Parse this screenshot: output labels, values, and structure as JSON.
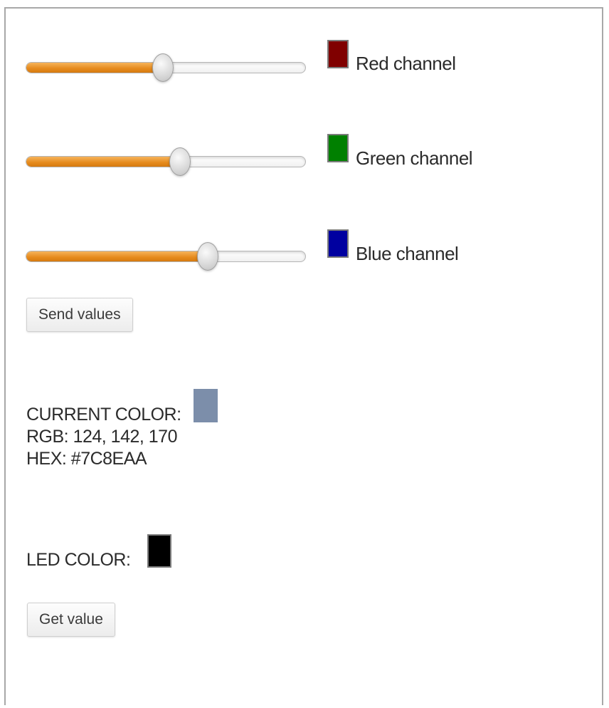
{
  "channels": [
    {
      "label": "Red channel",
      "level": 0.49,
      "swatch_color": "#800000"
    },
    {
      "label": "Green channel",
      "level": 0.55,
      "swatch_color": "#008000"
    },
    {
      "label": "Blue channel",
      "level": 0.65,
      "swatch_color": "#0000a0"
    }
  ],
  "send_button_label": "Send values",
  "current": {
    "title": "CURRENT COLOR:",
    "rgb_text": "RGB: 124, 142, 170",
    "hex_text": "HEX: #7C8EAA",
    "swatch_color": "#7C8EAA"
  },
  "led": {
    "title": "LED COLOR:",
    "swatch_color": "#000000"
  },
  "get_button_label": "Get value",
  "accent_color": "#e58a1c"
}
